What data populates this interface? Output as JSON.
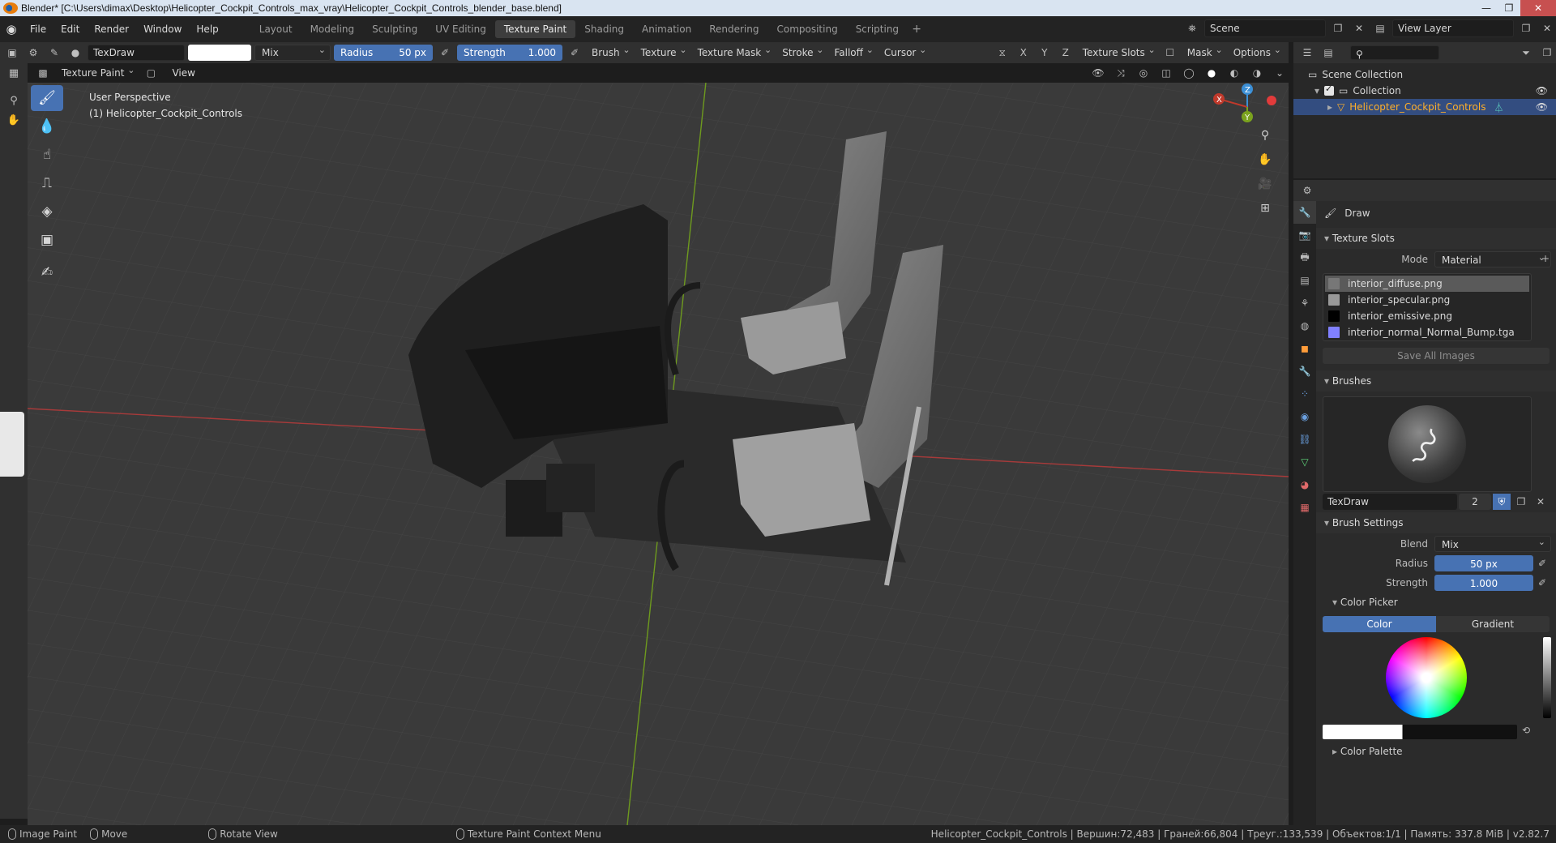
{
  "window": {
    "title": "Blender* [C:\\Users\\dimax\\Desktop\\Helicopter_Cockpit_Controls_max_vray\\Helicopter_Cockpit_Controls_blender_base.blend]"
  },
  "menubar": {
    "menus": [
      "File",
      "Edit",
      "Render",
      "Window",
      "Help"
    ],
    "workspaces": [
      "Layout",
      "Modeling",
      "Sculpting",
      "UV Editing",
      "Texture Paint",
      "Shading",
      "Animation",
      "Rendering",
      "Compositing",
      "Scripting"
    ],
    "active_workspace": "Texture Paint",
    "scene": "Scene",
    "view_layer": "View Layer"
  },
  "toolheader": {
    "brush_name": "TexDraw",
    "blend": "Mix",
    "radius_label": "Radius",
    "radius_value": "50 px",
    "strength_label": "Strength",
    "strength_value": "1.000",
    "menus": [
      "Brush",
      "Texture",
      "Texture Mask",
      "Stroke",
      "Falloff",
      "Cursor"
    ],
    "axes": [
      "X",
      "Y",
      "Z"
    ],
    "texture_slots": "Texture Slots",
    "mask": "Mask",
    "options": "Options"
  },
  "subheader": {
    "mode": "Texture Paint",
    "view": "View"
  },
  "viewport": {
    "perspective": "User Perspective",
    "object": "(1) Helicopter_Cockpit_Controls",
    "gizmo": {
      "x": "X",
      "y": "Y",
      "z": "Z"
    },
    "colors": {
      "x_axis": "#c0392b",
      "y_axis": "#7ba31e",
      "z_axis": "#3b8fd6"
    }
  },
  "outliner": {
    "scene_collection": "Scene Collection",
    "collection": "Collection",
    "object": "Helicopter_Cockpit_Controls"
  },
  "properties": {
    "tool_name": "Draw",
    "texture_slots": {
      "title": "Texture Slots",
      "mode_label": "Mode",
      "mode_value": "Material",
      "slots": [
        {
          "name": "interior_diffuse.png",
          "color": "#777777"
        },
        {
          "name": "interior_specular.png",
          "color": "#999999"
        },
        {
          "name": "interior_emissive.png",
          "color": "#000000"
        },
        {
          "name": "interior_normal_Normal_Bump.tga",
          "color": "#8080ff"
        }
      ],
      "save_all": "Save All Images"
    },
    "brushes": {
      "title": "Brushes",
      "brush": "TexDraw",
      "users": "2"
    },
    "brush_settings": {
      "title": "Brush Settings",
      "blend_label": "Blend",
      "blend_value": "Mix",
      "radius_label": "Radius",
      "radius_value": "50 px",
      "strength_label": "Strength",
      "strength_value": "1.000"
    },
    "color_picker": {
      "title": "Color Picker",
      "color_tab": "Color",
      "gradient_tab": "Gradient"
    },
    "color_palette": "Color Palette"
  },
  "statusbar": {
    "left": [
      "Image Paint",
      "Move",
      "Rotate View",
      "Texture Paint Context Menu"
    ],
    "stats": "Helicopter_Cockpit_Controls | Вершин:72,483 | Граней:66,804 | Треуг.:133,539 | Объектов:1/1 | Память: 337.8 MiB | v2.82.7"
  }
}
